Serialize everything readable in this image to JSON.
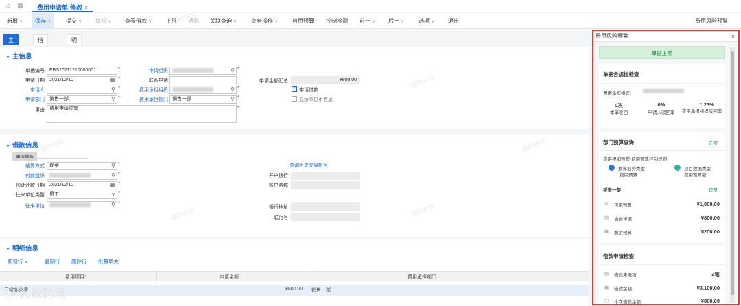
{
  "topbar": {
    "tab_label": "费用申请单-修改",
    "tab_close": "×"
  },
  "toolbar": {
    "items": [
      "新增",
      "保存",
      "提交",
      "审核",
      "查看借款",
      "下推",
      "退款",
      "关联查询",
      "业务操作",
      "可用预算",
      "控制检测",
      "前一",
      "后一",
      "选项",
      "退出"
    ],
    "right_label": "费用风险预警"
  },
  "subtabs": [
    "主信息",
    "借款信息",
    "明细信息"
  ],
  "main": {
    "title": "主信息",
    "fields": {
      "bill_no_label": "单据编号",
      "bill_no": "EBS20211210000001",
      "apply_date_label": "申请日期",
      "apply_date": "2021/12/10",
      "applicant_label": "申请人",
      "dept_label": "申请部门",
      "dept": "销售一部",
      "reason_label": "事由",
      "reason": "费用申请预警",
      "org_label": "申请组织",
      "phone_label": "联系电话",
      "cost_org_label": "费用承担组织",
      "cost_dept_label": "费用承担部门",
      "cost_dept": "销售一部",
      "amount_label": "申请金额汇总",
      "amount": "¥800.00",
      "borrow_label": "申请借款",
      "currency_label": "显示本位币信息"
    }
  },
  "loan": {
    "title": "借款信息",
    "badge": "申请借款",
    "settle_label": "结算方式",
    "settle": "现金",
    "pay_org_label": "付款组织",
    "repay_date_label": "预计还款日期",
    "repay_date": "2021/12/10",
    "unit_type_label": "往来单位类型",
    "unit_type": "员工",
    "unit_label": "往来单位",
    "history_link": "查询历史交易帐号",
    "bank_label": "开户银行",
    "account_label": "账户名称",
    "bank_addr_label": "银行地址",
    "bank_no_label": "联行号"
  },
  "detail": {
    "title": "明细信息",
    "actions": [
      "新增行",
      "复制行",
      "删除行",
      "批量填充"
    ],
    "columns": [
      "费用项目",
      "申请金额",
      "费用承担部门"
    ],
    "row": {
      "item": "日常办公费",
      "amount": "¥800.00",
      "dept": "销售一部"
    }
  },
  "risk": {
    "title": "费用风险预警",
    "status": "单据正常",
    "compliance": {
      "title": "单据合规性检查",
      "org_label": "费用承担组织:",
      "stats": [
        {
          "value": "0次",
          "label": "本单驳回"
        },
        {
          "value": "0%",
          "label": "申请人驳回率"
        },
        {
          "value": "1.25%",
          "label": "费用承担组织驳回率"
        }
      ]
    },
    "budget": {
      "title": "部门预算查询",
      "status": "正常",
      "rule": "费用报销预警-费用预算控制规则",
      "type1": "预算业务类型",
      "type1_sub": "费用预算",
      "type2": "项目数据类型",
      "type2_sub": "费用预算额",
      "dept": "销售一部",
      "dept_status": "正常",
      "rows": [
        {
          "label": "可用预算",
          "value": "¥1,000.00"
        },
        {
          "label": "当前单据",
          "value": "¥800.00"
        },
        {
          "label": "剩余预算",
          "value": "¥200.00"
        }
      ]
    },
    "loan": {
      "title": "借款申请检查",
      "rows": [
        {
          "label": "借款未报销",
          "value": "4笔"
        },
        {
          "label": "借款余额",
          "value": "¥3,100.00"
        },
        {
          "label": "本次借款余额",
          "value": "¥800.00"
        }
      ]
    }
  },
  "watermark": "临时许可",
  "logo_text": "大数跨境"
}
